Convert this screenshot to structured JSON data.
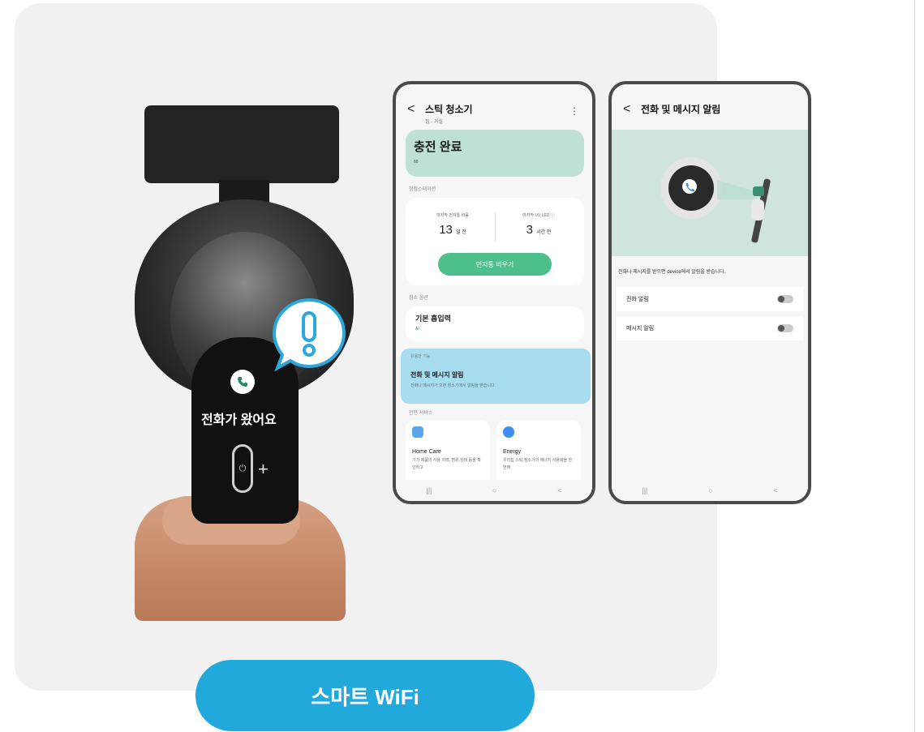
{
  "product": {
    "call_text": "전화가 왔어요",
    "icons": {
      "phone": "phone-icon",
      "alert": "exclamation-bubble-icon",
      "power": "power-icon",
      "plus": "plus-icon"
    },
    "plus_label": "+"
  },
  "phone1": {
    "back_glyph": "<",
    "title": "스틱 청소기",
    "subtitle": "집 - 거실",
    "more_glyph": "⋮",
    "status": "충전 완료",
    "status_small": "88",
    "station_label": "청정스테이션",
    "stat1_label": "마지막 먼지통 비움",
    "stat1_value": "13",
    "stat1_unit": "일 전",
    "stat2_label": "마지막 UV LED ⓘ",
    "stat2_value": "3",
    "stat2_unit": "시간 전",
    "empty_button": "먼지통 비우기",
    "options_label": "청소 옵션",
    "suction_title": "기본 흡입력",
    "suction_value": "AI",
    "useful_label": "유용한 기능",
    "notice_title": "전화 및 메시지 알림",
    "notice_sub": "전화나 메시지가 오면 청소기에서 알림을 받습니다.",
    "related_label": "관련 서비스",
    "svc1_title": "Home Care",
    "svc1_desc": "기기 제품의 사용 이력, 범위 상태 등을 확인하고",
    "svc2_title": "Energy",
    "svc2_desc": "우리집 스틱 청소기의 에너지 사용량을 한 번에",
    "nav": [
      "|||",
      "○",
      "<"
    ]
  },
  "phone2": {
    "back_glyph": "<",
    "title": "전화 및 메시지 알림",
    "desc": "전화나 메시지를 받으면 device에서 알림을 받습니다.",
    "toggle1": "전화 알림",
    "toggle2": "메시지 알림",
    "nav": [
      "|||",
      "○",
      "<"
    ]
  },
  "cta": {
    "label": "스마트 WiFi"
  },
  "colors": {
    "accent": "#21a9dc",
    "mint": "#bfe0d5",
    "green": "#4cbf8a",
    "notice": "#a8ddef"
  }
}
